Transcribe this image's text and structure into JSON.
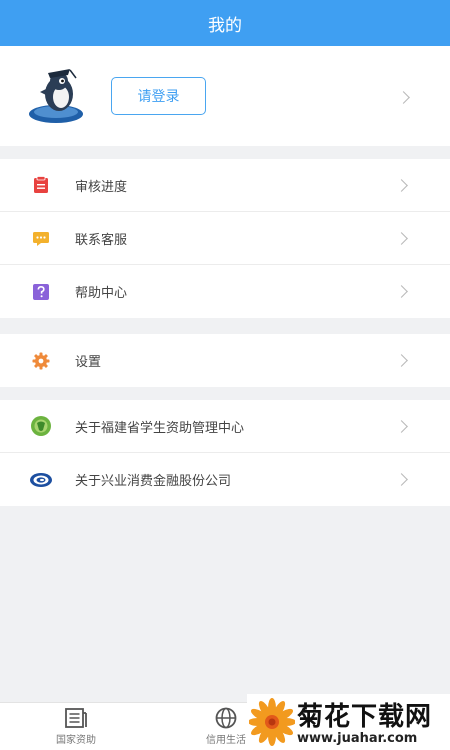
{
  "header": {
    "title": "我的"
  },
  "profile": {
    "login_label": "请登录"
  },
  "menu_group_1": [
    {
      "label": "审核进度",
      "icon": "clipboard-icon"
    },
    {
      "label": "联系客服",
      "icon": "chat-icon"
    },
    {
      "label": "帮助中心",
      "icon": "help-icon"
    }
  ],
  "menu_group_2": [
    {
      "label": "设置",
      "icon": "gear-icon"
    }
  ],
  "menu_group_3": [
    {
      "label": "关于福建省学生资助管理中心",
      "icon": "fujian-center-logo-icon"
    },
    {
      "label": "关于兴业消费金融股份公司",
      "icon": "cib-logo-icon"
    }
  ],
  "bottom_nav": [
    {
      "label": "国家资助",
      "icon": "newspaper-icon"
    },
    {
      "label": "信用生活",
      "icon": "globe-icon"
    }
  ],
  "watermark": {
    "title": "菊花下载网",
    "url": "www.juahar.com"
  },
  "colors": {
    "accent": "#3f9ff2",
    "background": "#f0f1f3"
  }
}
